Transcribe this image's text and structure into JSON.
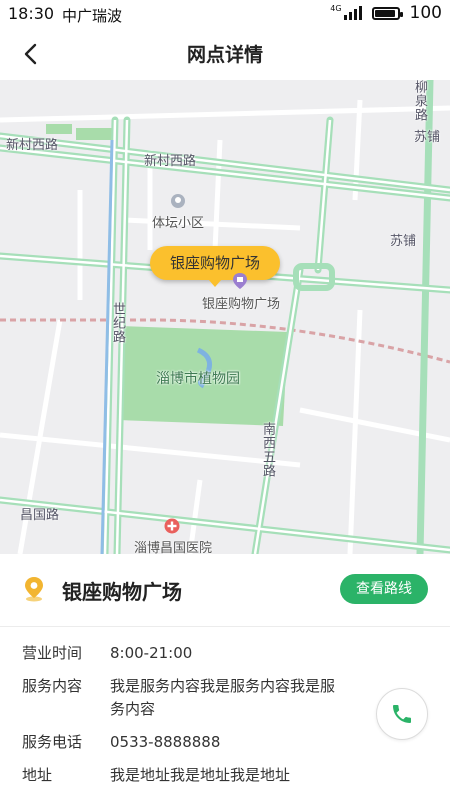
{
  "status": {
    "time": "18:30",
    "carrier": "中广瑞波",
    "network": "4G",
    "battery_text": "100",
    "battery_level": 1.0
  },
  "nav": {
    "title": "网点详情",
    "back_icon": "chevron-left-icon"
  },
  "map": {
    "callout": "银座购物广场",
    "labels": {
      "xincun_west_1": "新村西路",
      "xincun_west_2": "新村西路",
      "liuquan": "柳泉路",
      "supu_1": "苏铺",
      "supu_2": "苏铺",
      "tiyan": "体坛小区",
      "mall": "银座购物广场",
      "shiji": "世纪路",
      "botanical": "淄博市植物园",
      "nanxi": "南西五路",
      "changguo": "昌国路",
      "hospital": "淄博昌国医院"
    },
    "colors": {
      "road_green": "#a6dfb9",
      "park": "#a8dcaa",
      "background": "#eeeef0",
      "rail": "#d9a3a6"
    }
  },
  "card": {
    "name": "银座购物广场",
    "route_button": "查看路线",
    "location_icon": "location-pin-icon",
    "phone_icon": "phone-icon",
    "accent": "#2bb368",
    "rows": [
      {
        "key": "营业时间",
        "value": "8:00-21:00"
      },
      {
        "key": "服务内容",
        "value": "我是服务内容我是服务内容我是服务内容"
      },
      {
        "key": "服务电话",
        "value": "0533-8888888"
      },
      {
        "key": "地址",
        "value": "我是地址我是地址我是地址"
      }
    ]
  }
}
